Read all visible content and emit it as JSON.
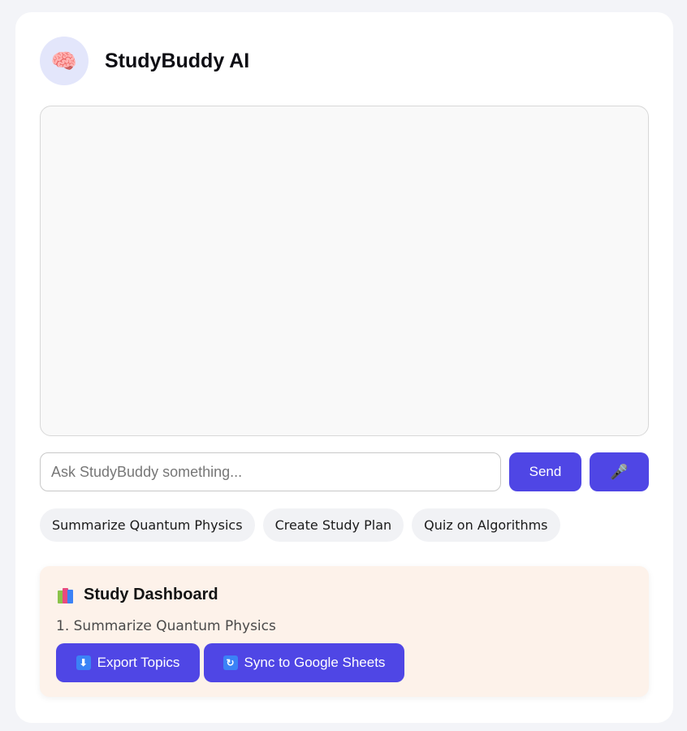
{
  "app": {
    "title": "StudyBuddy AI",
    "avatar_icon": "🧠"
  },
  "chat": {
    "input_placeholder": "Ask StudyBuddy something...",
    "input_value": "",
    "send_label": "Send",
    "mic_icon": "🎤"
  },
  "suggestions": [
    {
      "label": "Summarize Quantum Physics"
    },
    {
      "label": "Create Study Plan"
    },
    {
      "label": "Quiz on Algorithms"
    }
  ],
  "dashboard": {
    "title": "Study Dashboard",
    "items": [
      {
        "text": "1. Summarize Quantum Physics"
      }
    ],
    "export_label": "Export Topics",
    "export_icon": "⬇",
    "sync_label": "Sync to Google Sheets",
    "sync_icon": "↻"
  },
  "colors": {
    "accent": "#4f46e5",
    "dashboard_bg": "#fdf2ea",
    "avatar_bg": "#e3e6fb"
  }
}
